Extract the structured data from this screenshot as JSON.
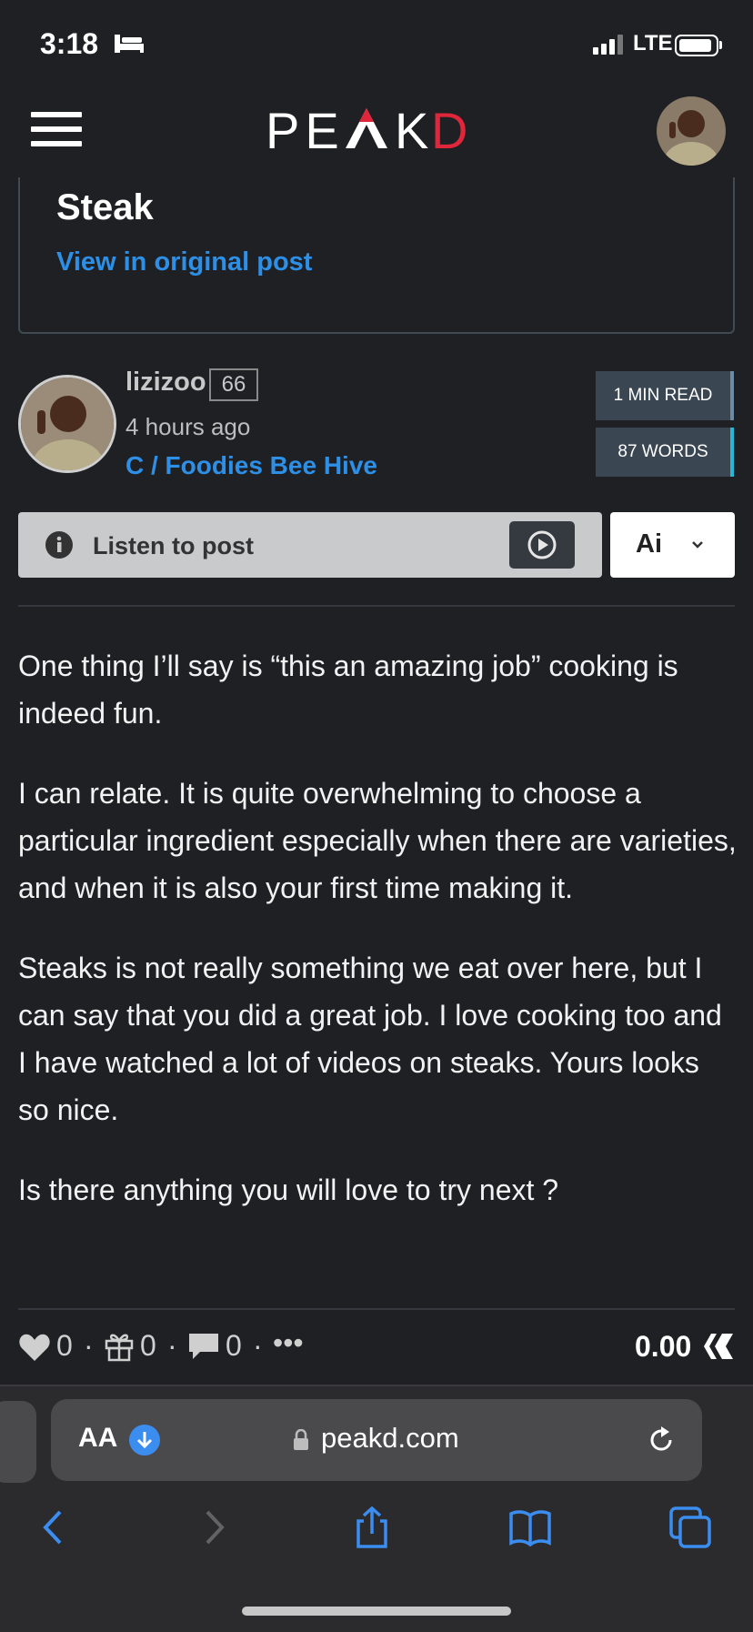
{
  "status_bar": {
    "time": "3:18",
    "network": "LTE"
  },
  "app": {
    "logo_text": "PEAKD"
  },
  "card": {
    "title": "Steak",
    "link": "View in original post"
  },
  "author": {
    "name": "lizizoo",
    "reputation": "66",
    "time_ago": "4 hours ago",
    "community": "C / Foodies Bee Hive"
  },
  "stats": {
    "read_time": "1 MIN READ",
    "words": "87 WORDS"
  },
  "listen": {
    "label": "Listen to post",
    "ai_label": "Ai"
  },
  "content": {
    "paragraphs": [
      "One thing I’ll say is “this an amazing job” cooking is indeed fun.",
      "I can relate. It is quite overwhelming to choose a particular ingredient especially when there are varieties, and when it is also your first time making it.",
      "Steaks is not really something we eat over here, but I can say that you did a great job. I love cooking too and I have watched a lot of videos on steaks. Yours looks so nice.",
      "Is there anything you will love to try next ?"
    ]
  },
  "footer": {
    "votes": "0",
    "gifts": "0",
    "comments": "0",
    "more": "•••",
    "payout": "0.00"
  },
  "browser": {
    "aa": "AA",
    "url": "peakd.com"
  },
  "colors": {
    "link": "#2e8fe6",
    "logo_accent": "#e0263a",
    "background": "#1e2024"
  }
}
